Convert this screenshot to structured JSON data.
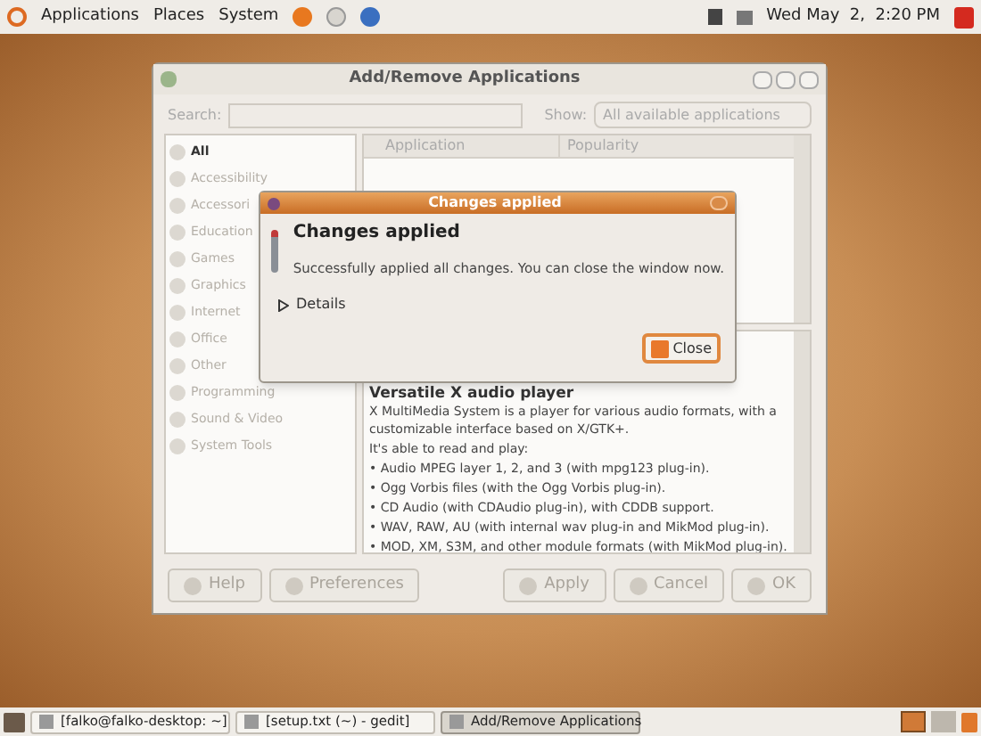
{
  "top_panel": {
    "menus": [
      "Applications",
      "Places",
      "System"
    ],
    "clock": "Wed May  2,  2:20 PM"
  },
  "main_window": {
    "title": "Add/Remove Applications",
    "search_label": "Search:",
    "show_label": "Show:",
    "show_value": "All available applications",
    "categories": [
      {
        "label": "All",
        "selected": true
      },
      {
        "label": "Accessibility",
        "selected": false
      },
      {
        "label": "Accessori",
        "selected": false
      },
      {
        "label": "Education",
        "selected": false
      },
      {
        "label": "Games",
        "selected": false
      },
      {
        "label": "Graphics",
        "selected": false
      },
      {
        "label": "Internet",
        "selected": false
      },
      {
        "label": "Office",
        "selected": false
      },
      {
        "label": "Other",
        "selected": false
      },
      {
        "label": "Programming",
        "selected": false
      },
      {
        "label": "Sound & Video",
        "selected": false
      },
      {
        "label": "System Tools",
        "selected": false
      }
    ],
    "columns": [
      "Application",
      "Popularity"
    ],
    "description": {
      "heading": "Versatile X audio player",
      "intro": "X MultiMedia System is a player for various audio formats, with a customizable interface based on X/GTK+.",
      "subheading": "It's able to read and play:",
      "bullets": [
        "• Audio MPEG layer 1, 2, and 3 (with mpg123 plug-in).",
        "• Ogg Vorbis files (with the Ogg Vorbis plug-in).",
        "• CD Audio (with CDAudio plug-in), with CDDB support.",
        "• WAV, RAW, AU (with internal wav plug-in and MikMod plug-in).",
        "• MOD, XM, S3M, and other module formats (with MikMod plug-in)."
      ]
    },
    "buttons": [
      {
        "label": "Help",
        "disabled": true,
        "kind": "left"
      },
      {
        "label": "Preferences",
        "disabled": true,
        "kind": "left"
      },
      {
        "label": "Apply",
        "disabled": true,
        "kind": "right"
      },
      {
        "label": "Cancel",
        "disabled": true,
        "kind": "right"
      },
      {
        "label": "OK",
        "disabled": true,
        "kind": "right"
      }
    ]
  },
  "dialog": {
    "title": "Changes applied",
    "heading": "Changes applied",
    "message": "Successfully applied all changes. You can close the window now.",
    "details": {
      "label": "Details",
      "expanded": false
    },
    "button": "Close"
  },
  "taskbar": [
    {
      "label": "[falko@falko-desktop: ~]",
      "selected": false
    },
    {
      "label": "[setup.txt (~) - gedit]",
      "selected": false
    },
    {
      "label": "Add/Remove Applications",
      "selected": true
    }
  ]
}
